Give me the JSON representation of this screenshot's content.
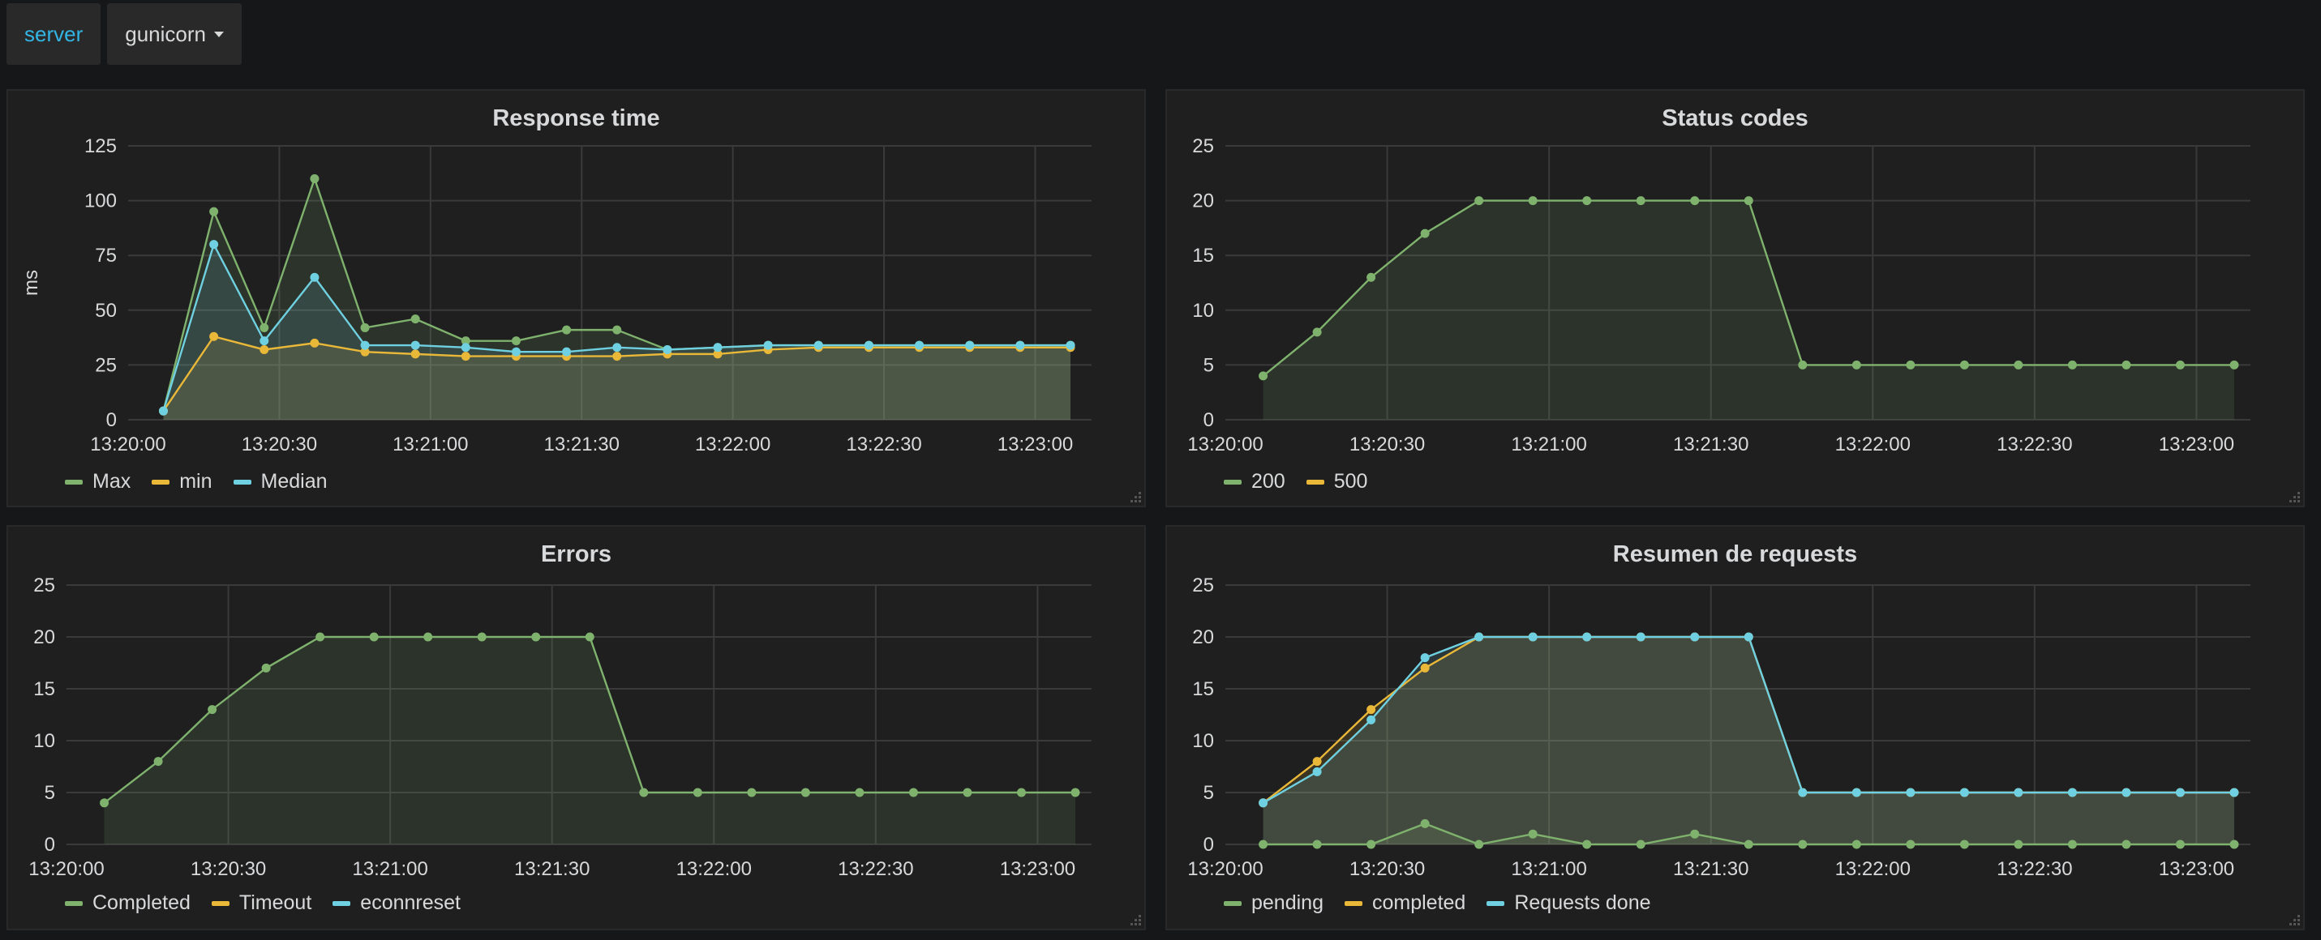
{
  "template_vars": {
    "label": "server",
    "value": "gunicorn"
  },
  "colors": {
    "green": "#7eb26d",
    "yellow": "#eab839",
    "blue": "#6ed0e0",
    "grid": "#3a3a3b",
    "panel_bg": "#1f1f20",
    "page_bg": "#161719",
    "fill": "#3a4230"
  },
  "time_ticks": [
    "13:20:00",
    "13:20:30",
    "13:21:00",
    "13:21:30",
    "13:22:00",
    "13:22:30",
    "13:23:00"
  ],
  "chart_data": [
    {
      "type": "line",
      "title": "Response time",
      "ylabel": "ms",
      "xlabel": "",
      "ylim": [
        0,
        125
      ],
      "yticks": [
        "0",
        "25",
        "50",
        "75",
        "100",
        "125"
      ],
      "xlim": [
        "13:20:00",
        "13:23:10"
      ],
      "x": [
        "13:20:07",
        "13:20:17",
        "13:20:27",
        "13:20:37",
        "13:20:47",
        "13:20:57",
        "13:21:07",
        "13:21:17",
        "13:21:27",
        "13:21:37",
        "13:21:47",
        "13:21:57",
        "13:22:07",
        "13:22:17",
        "13:22:27",
        "13:22:37",
        "13:22:47",
        "13:22:57",
        "13:23:07"
      ],
      "series": [
        {
          "name": "Max",
          "color": "#7eb26d",
          "values": [
            4,
            95,
            42,
            110,
            42,
            46,
            36,
            36,
            41,
            41,
            32,
            33,
            34,
            34,
            34,
            34,
            34,
            34,
            34
          ]
        },
        {
          "name": "min",
          "color": "#eab839",
          "values": [
            4,
            38,
            32,
            35,
            31,
            30,
            29,
            29,
            29,
            29,
            30,
            30,
            32,
            33,
            33,
            33,
            33,
            33,
            33
          ]
        },
        {
          "name": "Median",
          "color": "#6ed0e0",
          "values": [
            4,
            80,
            36,
            65,
            34,
            34,
            33,
            31,
            31,
            33,
            32,
            33,
            34,
            34,
            34,
            34,
            34,
            34,
            34
          ]
        }
      ],
      "legend": "bottom-left",
      "grid": true
    },
    {
      "type": "line",
      "title": "Status codes",
      "ylabel": "",
      "xlabel": "",
      "ylim": [
        0,
        25
      ],
      "yticks": [
        "0",
        "5",
        "10",
        "15",
        "20",
        "25"
      ],
      "xlim": [
        "13:20:00",
        "13:23:10"
      ],
      "x": [
        "13:20:07",
        "13:20:17",
        "13:20:27",
        "13:20:37",
        "13:20:47",
        "13:20:57",
        "13:21:07",
        "13:21:17",
        "13:21:27",
        "13:21:37",
        "13:21:47",
        "13:21:57",
        "13:22:07",
        "13:22:17",
        "13:22:27",
        "13:22:37",
        "13:22:47",
        "13:22:57",
        "13:23:07"
      ],
      "series": [
        {
          "name": "200",
          "color": "#7eb26d",
          "values": [
            4,
            8,
            13,
            17,
            20,
            20,
            20,
            20,
            20,
            20,
            5,
            5,
            5,
            5,
            5,
            5,
            5,
            5,
            5
          ]
        },
        {
          "name": "500",
          "color": "#eab839",
          "values": []
        }
      ],
      "legend": "bottom-left",
      "grid": true
    },
    {
      "type": "line",
      "title": "Errors",
      "ylabel": "",
      "xlabel": "",
      "ylim": [
        0,
        25
      ],
      "yticks": [
        "0",
        "5",
        "10",
        "15",
        "20",
        "25"
      ],
      "xlim": [
        "13:20:00",
        "13:23:10"
      ],
      "x": [
        "13:20:07",
        "13:20:17",
        "13:20:27",
        "13:20:37",
        "13:20:47",
        "13:20:57",
        "13:21:07",
        "13:21:17",
        "13:21:27",
        "13:21:37",
        "13:21:47",
        "13:21:57",
        "13:22:07",
        "13:22:17",
        "13:22:27",
        "13:22:37",
        "13:22:47",
        "13:22:57",
        "13:23:07"
      ],
      "series": [
        {
          "name": "Completed",
          "color": "#7eb26d",
          "values": [
            4,
            8,
            13,
            17,
            20,
            20,
            20,
            20,
            20,
            20,
            5,
            5,
            5,
            5,
            5,
            5,
            5,
            5,
            5
          ]
        },
        {
          "name": "Timeout",
          "color": "#eab839",
          "values": []
        },
        {
          "name": "econnreset",
          "color": "#6ed0e0",
          "values": []
        }
      ],
      "legend": "bottom-left",
      "grid": true
    },
    {
      "type": "line",
      "title": "Resumen de requests",
      "ylabel": "",
      "xlabel": "",
      "ylim": [
        0,
        25
      ],
      "yticks": [
        "0",
        "5",
        "10",
        "15",
        "20",
        "25"
      ],
      "xlim": [
        "13:20:00",
        "13:23:10"
      ],
      "x": [
        "13:20:07",
        "13:20:17",
        "13:20:27",
        "13:20:37",
        "13:20:47",
        "13:20:57",
        "13:21:07",
        "13:21:17",
        "13:21:27",
        "13:21:37",
        "13:21:47",
        "13:21:57",
        "13:22:07",
        "13:22:17",
        "13:22:27",
        "13:22:37",
        "13:22:47",
        "13:22:57",
        "13:23:07"
      ],
      "series": [
        {
          "name": "pending",
          "color": "#7eb26d",
          "values": [
            0,
            0,
            0,
            2,
            0,
            1,
            0,
            0,
            1,
            0,
            0,
            0,
            0,
            0,
            0,
            0,
            0,
            0,
            0
          ]
        },
        {
          "name": "completed",
          "color": "#eab839",
          "values": [
            4,
            8,
            13,
            17,
            20,
            20,
            20,
            20,
            20,
            20,
            5,
            5,
            5,
            5,
            5,
            5,
            5,
            5,
            5
          ]
        },
        {
          "name": "Requests done",
          "color": "#6ed0e0",
          "values": [
            4,
            7,
            12,
            18,
            20,
            20,
            20,
            20,
            20,
            20,
            5,
            5,
            5,
            5,
            5,
            5,
            5,
            5,
            5
          ]
        }
      ],
      "legend": "bottom-left",
      "grid": true
    }
  ]
}
